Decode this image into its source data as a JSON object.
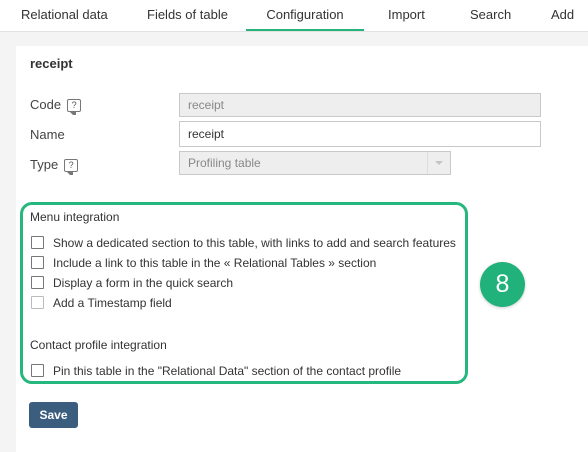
{
  "tabs": [
    {
      "label": "Relational data"
    },
    {
      "label": "Fields of table"
    },
    {
      "label": "Configuration",
      "active": true
    },
    {
      "label": "Import"
    },
    {
      "label": "Search"
    },
    {
      "label": "Add"
    }
  ],
  "form": {
    "title": "receipt",
    "code": {
      "label": "Code",
      "value": "receipt",
      "disabled": true
    },
    "name": {
      "label": "Name",
      "value": "receipt"
    },
    "type": {
      "label": "Type",
      "value": "Profiling table",
      "disabled": true
    },
    "help_glyph": "?"
  },
  "menu_integration": {
    "label": "Menu integration",
    "options": [
      {
        "label": "Show a dedicated section to this table, with links to add and search features",
        "checked": false
      },
      {
        "label": "Include a link to this table in the « Relational Tables » section",
        "checked": false
      },
      {
        "label": "Display a form in the quick search",
        "checked": false
      },
      {
        "label": "Add a Timestamp field",
        "checked": false,
        "disabled": true
      }
    ]
  },
  "contact_profile_integration": {
    "label": "Contact profile integration",
    "options": [
      {
        "label": "Pin this table in the \"Relational Data\" section of the contact profile",
        "checked": false
      }
    ]
  },
  "callout": {
    "number": "8"
  },
  "save_label": "Save",
  "colors": {
    "accent_green": "#25b77d",
    "save_button": "#3b5e7f",
    "active_tab_underline": "#26b47a"
  }
}
